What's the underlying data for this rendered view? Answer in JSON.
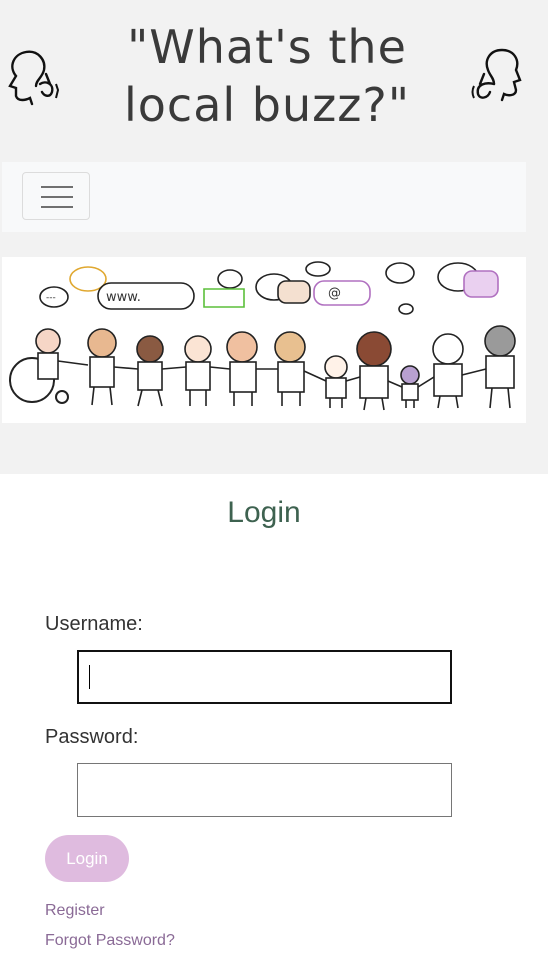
{
  "header": {
    "title_line1": "\"What's the",
    "title_line2": "local buzz?\"",
    "left_icon": "gossip-head-icon",
    "right_icon": "listening-head-icon"
  },
  "navbar": {
    "toggler_icon": "hamburger-menu-icon"
  },
  "banner": {
    "speech_bubble_text": "www.",
    "at_symbol": "@",
    "ellipsis": "---"
  },
  "login": {
    "title": "Login",
    "username_label": "Username:",
    "username_value": "",
    "password_label": "Password:",
    "password_value": "",
    "button_label": "Login",
    "register_link": "Register",
    "forgot_link": "Forgot Password?"
  },
  "colors": {
    "accent_button": "#dfbbdf",
    "title_green": "#3e6250",
    "link_purple": "#8a6a96"
  }
}
